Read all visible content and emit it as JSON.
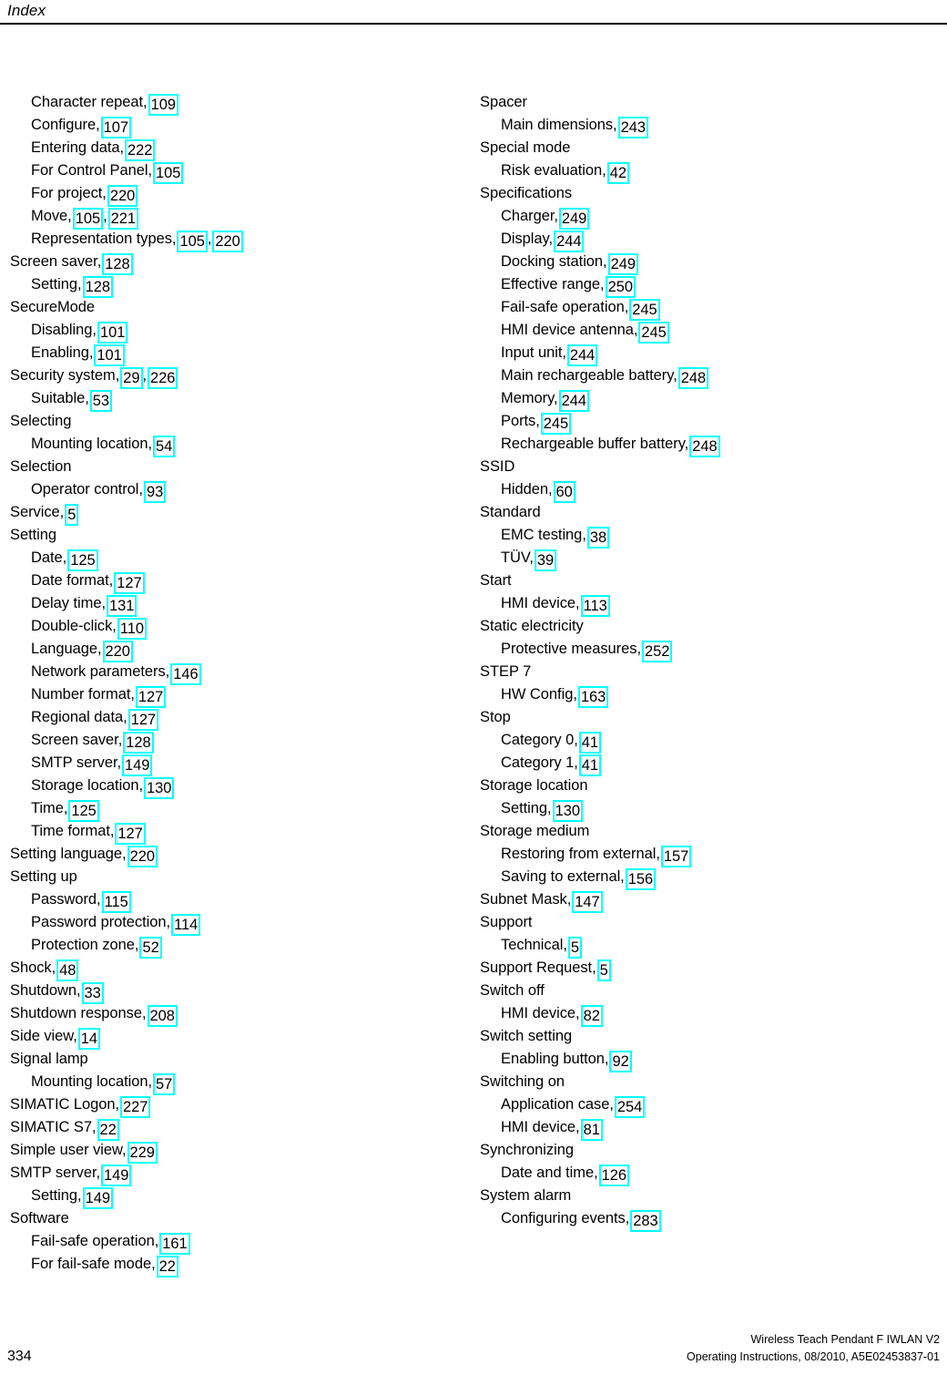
{
  "header": {
    "title": "Index"
  },
  "highlight_color": "#00FFFF",
  "columns": {
    "left": [
      {
        "level": "sub",
        "label": "Character repeat,",
        "refs": [
          "109"
        ]
      },
      {
        "level": "sub",
        "label": "Configure,",
        "refs": [
          "107"
        ]
      },
      {
        "level": "sub",
        "label": "Entering data,",
        "refs": [
          "222"
        ]
      },
      {
        "level": "sub",
        "label": "For Control Panel,",
        "refs": [
          "105"
        ]
      },
      {
        "level": "sub",
        "label": "For project,",
        "refs": [
          "220"
        ]
      },
      {
        "level": "sub",
        "label": "Move,",
        "refs": [
          "105",
          "221"
        ]
      },
      {
        "level": "sub",
        "label": "Representation types,",
        "refs": [
          "105",
          "220"
        ]
      },
      {
        "level": "top",
        "label": "Screen saver,",
        "refs": [
          "128"
        ]
      },
      {
        "level": "sub",
        "label": "Setting,",
        "refs": [
          "128"
        ]
      },
      {
        "level": "top",
        "label": "SecureMode",
        "refs": []
      },
      {
        "level": "sub",
        "label": "Disabling,",
        "refs": [
          "101"
        ]
      },
      {
        "level": "sub",
        "label": "Enabling,",
        "refs": [
          "101"
        ]
      },
      {
        "level": "top",
        "label": "Security system,",
        "refs": [
          "29",
          "226"
        ]
      },
      {
        "level": "sub",
        "label": "Suitable,",
        "refs": [
          "53"
        ]
      },
      {
        "level": "top",
        "label": "Selecting",
        "refs": []
      },
      {
        "level": "sub",
        "label": "Mounting location,",
        "refs": [
          "54"
        ]
      },
      {
        "level": "top",
        "label": "Selection",
        "refs": []
      },
      {
        "level": "sub",
        "label": "Operator control,",
        "refs": [
          "93"
        ]
      },
      {
        "level": "top",
        "label": "Service,",
        "refs": [
          "5"
        ]
      },
      {
        "level": "top",
        "label": "Setting",
        "refs": []
      },
      {
        "level": "sub",
        "label": "Date,",
        "refs": [
          "125"
        ]
      },
      {
        "level": "sub",
        "label": "Date format,",
        "refs": [
          "127"
        ]
      },
      {
        "level": "sub",
        "label": "Delay time,",
        "refs": [
          "131"
        ]
      },
      {
        "level": "sub",
        "label": "Double-click,",
        "refs": [
          "110"
        ]
      },
      {
        "level": "sub",
        "label": "Language,",
        "refs": [
          "220"
        ]
      },
      {
        "level": "sub",
        "label": "Network parameters,",
        "refs": [
          "146"
        ]
      },
      {
        "level": "sub",
        "label": "Number format,",
        "refs": [
          "127"
        ]
      },
      {
        "level": "sub",
        "label": "Regional data,",
        "refs": [
          "127"
        ]
      },
      {
        "level": "sub",
        "label": "Screen saver,",
        "refs": [
          "128"
        ]
      },
      {
        "level": "sub",
        "label": "SMTP server,",
        "refs": [
          "149"
        ]
      },
      {
        "level": "sub",
        "label": "Storage location,",
        "refs": [
          "130"
        ]
      },
      {
        "level": "sub",
        "label": "Time,",
        "refs": [
          "125"
        ]
      },
      {
        "level": "sub",
        "label": "Time format,",
        "refs": [
          "127"
        ]
      },
      {
        "level": "top",
        "label": "Setting language,",
        "refs": [
          "220"
        ]
      },
      {
        "level": "top",
        "label": "Setting up",
        "refs": []
      },
      {
        "level": "sub",
        "label": "Password,",
        "refs": [
          "115"
        ]
      },
      {
        "level": "sub",
        "label": "Password protection,",
        "refs": [
          "114"
        ]
      },
      {
        "level": "sub",
        "label": "Protection zone,",
        "refs": [
          "52"
        ]
      },
      {
        "level": "top",
        "label": "Shock,",
        "refs": [
          "48"
        ]
      },
      {
        "level": "top",
        "label": "Shutdown,",
        "refs": [
          "33"
        ]
      },
      {
        "level": "top",
        "label": "Shutdown response,",
        "refs": [
          "208"
        ]
      },
      {
        "level": "top",
        "label": "Side view,",
        "refs": [
          "14"
        ]
      },
      {
        "level": "top",
        "label": "Signal lamp",
        "refs": []
      },
      {
        "level": "sub",
        "label": "Mounting location,",
        "refs": [
          "57"
        ]
      },
      {
        "level": "top",
        "label": "SIMATIC Logon,",
        "refs": [
          "227"
        ]
      },
      {
        "level": "top",
        "label": "SIMATIC S7,",
        "refs": [
          "22"
        ]
      },
      {
        "level": "top",
        "label": "Simple user view,",
        "refs": [
          "229"
        ]
      },
      {
        "level": "top",
        "label": "SMTP server,",
        "refs": [
          "149"
        ]
      },
      {
        "level": "sub",
        "label": "Setting,",
        "refs": [
          "149"
        ]
      },
      {
        "level": "top",
        "label": "Software",
        "refs": []
      },
      {
        "level": "sub",
        "label": "Fail-safe operation,",
        "refs": [
          "161"
        ]
      },
      {
        "level": "sub",
        "label": "For fail-safe mode,",
        "refs": [
          "22"
        ]
      }
    ],
    "right": [
      {
        "level": "top",
        "label": "Spacer",
        "refs": []
      },
      {
        "level": "sub",
        "label": "Main dimensions,",
        "refs": [
          "243"
        ]
      },
      {
        "level": "top",
        "label": "Special mode",
        "refs": []
      },
      {
        "level": "sub",
        "label": "Risk evaluation,",
        "refs": [
          "42"
        ]
      },
      {
        "level": "top",
        "label": "Specifications",
        "refs": []
      },
      {
        "level": "sub",
        "label": "Charger,",
        "refs": [
          "249"
        ]
      },
      {
        "level": "sub",
        "label": "Display,",
        "refs": [
          "244"
        ]
      },
      {
        "level": "sub",
        "label": "Docking station,",
        "refs": [
          "249"
        ]
      },
      {
        "level": "sub",
        "label": "Effective range,",
        "refs": [
          "250"
        ]
      },
      {
        "level": "sub",
        "label": "Fail-safe operation,",
        "refs": [
          "245"
        ]
      },
      {
        "level": "sub",
        "label": "HMI device antenna,",
        "refs": [
          "245"
        ]
      },
      {
        "level": "sub",
        "label": "Input unit,",
        "refs": [
          "244"
        ]
      },
      {
        "level": "sub",
        "label": "Main rechargeable battery,",
        "refs": [
          "248"
        ]
      },
      {
        "level": "sub",
        "label": "Memory,",
        "refs": [
          "244"
        ]
      },
      {
        "level": "sub",
        "label": "Ports,",
        "refs": [
          "245"
        ]
      },
      {
        "level": "sub",
        "label": "Rechargeable buffer battery,",
        "refs": [
          "248"
        ]
      },
      {
        "level": "top",
        "label": "SSID",
        "refs": []
      },
      {
        "level": "sub",
        "label": "Hidden,",
        "refs": [
          "60"
        ]
      },
      {
        "level": "top",
        "label": "Standard",
        "refs": []
      },
      {
        "level": "sub",
        "label": "EMC testing,",
        "refs": [
          "38"
        ]
      },
      {
        "level": "sub",
        "label": "TÜV,",
        "refs": [
          "39"
        ]
      },
      {
        "level": "top",
        "label": "Start",
        "refs": []
      },
      {
        "level": "sub",
        "label": "HMI device,",
        "refs": [
          "113"
        ]
      },
      {
        "level": "top",
        "label": "Static electricity",
        "refs": []
      },
      {
        "level": "sub",
        "label": "Protective measures,",
        "refs": [
          "252"
        ]
      },
      {
        "level": "top",
        "label": "STEP 7",
        "refs": []
      },
      {
        "level": "sub",
        "label": "HW Config,",
        "refs": [
          "163"
        ]
      },
      {
        "level": "top",
        "label": "Stop",
        "refs": []
      },
      {
        "level": "sub",
        "label": "Category 0,",
        "refs": [
          "41"
        ]
      },
      {
        "level": "sub",
        "label": "Category 1,",
        "refs": [
          "41"
        ]
      },
      {
        "level": "top",
        "label": "Storage location",
        "refs": []
      },
      {
        "level": "sub",
        "label": "Setting,",
        "refs": [
          "130"
        ]
      },
      {
        "level": "top",
        "label": "Storage medium",
        "refs": []
      },
      {
        "level": "sub",
        "label": "Restoring from external,",
        "refs": [
          "157"
        ]
      },
      {
        "level": "sub",
        "label": "Saving to external,",
        "refs": [
          "156"
        ]
      },
      {
        "level": "top",
        "label": "Subnet Mask,",
        "refs": [
          "147"
        ]
      },
      {
        "level": "top",
        "label": "Support",
        "refs": []
      },
      {
        "level": "sub",
        "label": "Technical,",
        "refs": [
          "5"
        ]
      },
      {
        "level": "top",
        "label": "Support Request,",
        "refs": [
          "5"
        ]
      },
      {
        "level": "top",
        "label": "Switch off",
        "refs": []
      },
      {
        "level": "sub",
        "label": "HMI device,",
        "refs": [
          "82"
        ]
      },
      {
        "level": "top",
        "label": "Switch setting",
        "refs": []
      },
      {
        "level": "sub",
        "label": "Enabling button,",
        "refs": [
          "92"
        ]
      },
      {
        "level": "top",
        "label": "Switching on",
        "refs": []
      },
      {
        "level": "sub",
        "label": "Application case,",
        "refs": [
          "254"
        ]
      },
      {
        "level": "sub",
        "label": "HMI device,",
        "refs": [
          "81"
        ]
      },
      {
        "level": "top",
        "label": "Synchronizing",
        "refs": []
      },
      {
        "level": "sub",
        "label": "Date and time,",
        "refs": [
          "126"
        ]
      },
      {
        "level": "top",
        "label": "System alarm",
        "refs": []
      },
      {
        "level": "sub",
        "label": "Configuring events,",
        "refs": [
          "283"
        ]
      }
    ]
  },
  "footer": {
    "page_number": "334",
    "product_line": "Wireless Teach Pendant F IWLAN V2",
    "doc_line": "Operating Instructions, 08/2010, A5E02453837-01"
  }
}
